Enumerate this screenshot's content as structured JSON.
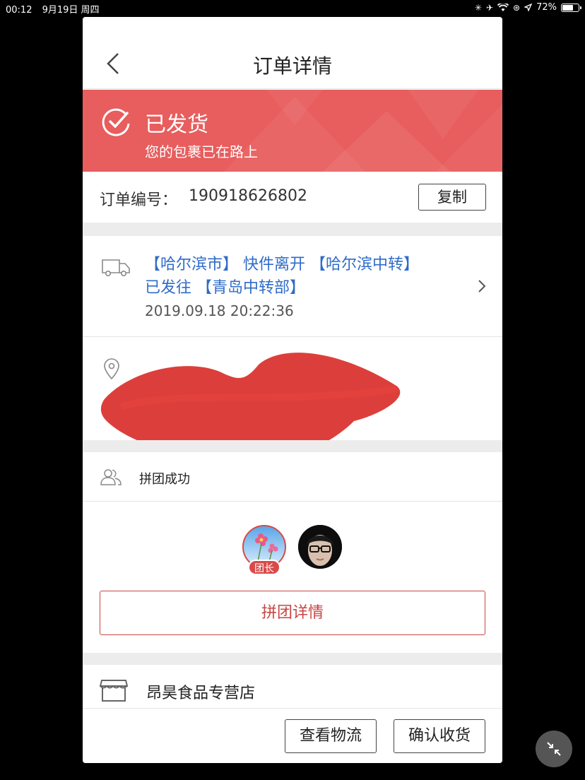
{
  "status_bar": {
    "time": "00:12",
    "date": "9月19日 周四",
    "battery": "72%",
    "battery_level": 0.72
  },
  "nav": {
    "title": "订单详情",
    "back_icon": "chevron-left-icon"
  },
  "shipping_status": {
    "title": "已发货",
    "subtitle": "您的包裹已在路上",
    "color": "#e85d5d"
  },
  "order": {
    "label": "订单编号：",
    "number": "190918626802",
    "copy_label": "复制"
  },
  "logistics": {
    "text": "【哈尔滨市】 快件离开 【哈尔滨中转】 已发往 【青岛中转部】",
    "time": "2019.09.18 20:22:36",
    "link_color": "#2f6cc8"
  },
  "group": {
    "title": "拼团成功",
    "leader_badge": "团长",
    "detail_label": "拼团详情",
    "accent_color": "#c94545"
  },
  "store": {
    "name": "昂昊食品专营店"
  },
  "bottom_actions": {
    "view_logistics": "查看物流",
    "confirm_receipt": "确认收货"
  }
}
